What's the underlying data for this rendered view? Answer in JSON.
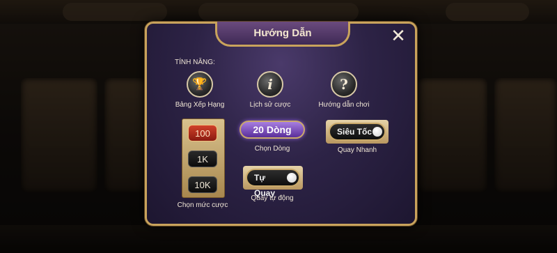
{
  "dialog": {
    "title": "Hướng Dẫn",
    "close_glyph": "✕",
    "section_label": "TÍNH NĂNG:"
  },
  "features": [
    {
      "label": "Bảng Xếp Hạng",
      "icon": "trophy-icon",
      "glyph": "🏆"
    },
    {
      "label": "Lịch sử cược",
      "icon": "info-icon",
      "glyph": "i"
    },
    {
      "label": "Hướng dẫn chơi",
      "icon": "question-icon",
      "glyph": "?"
    }
  ],
  "bets": {
    "options": [
      "100",
      "1K",
      "10K"
    ],
    "selected": "100",
    "caption": "Chọn mức cược"
  },
  "lines": {
    "value": "20 Dòng",
    "caption": "Chọn Dòng"
  },
  "fast_spin": {
    "label": "Siêu Tốc",
    "caption": "Quay Nhanh"
  },
  "auto_spin": {
    "label": "Tự Quay",
    "caption": "Quay tự động"
  },
  "colors": {
    "accent_gold": "#c9a35c",
    "panel_purple": "#2d2346",
    "active_bet": "#c0392b",
    "lines_purple": "#7b4bc0"
  }
}
